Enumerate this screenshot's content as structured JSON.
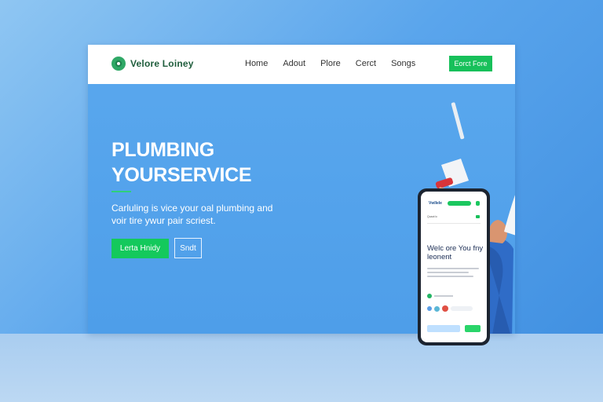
{
  "header": {
    "brand": "Velore Loiney",
    "nav": [
      "Home",
      "Adout",
      "Plore",
      "Cerct",
      "Songs"
    ],
    "cta": "Eorct Fore"
  },
  "hero": {
    "title_line1": "PLUMBING",
    "title_line2": "YOURSERVICE",
    "subtitle_line1": "Carluling is vice your oal plumbing and",
    "subtitle_line2": "voir tire ywur pair scriest.",
    "primary_button": "Lerta Hnidy",
    "secondary_button": "Sndt"
  },
  "phone": {
    "brand": "Vwllele",
    "chip": "Qoaot lc",
    "headline": "Welc ore You fny leonent"
  },
  "colors": {
    "accent_green": "#17c05a",
    "hero_blue": "#4e9ee9",
    "brand_text": "#1f5d3c"
  }
}
